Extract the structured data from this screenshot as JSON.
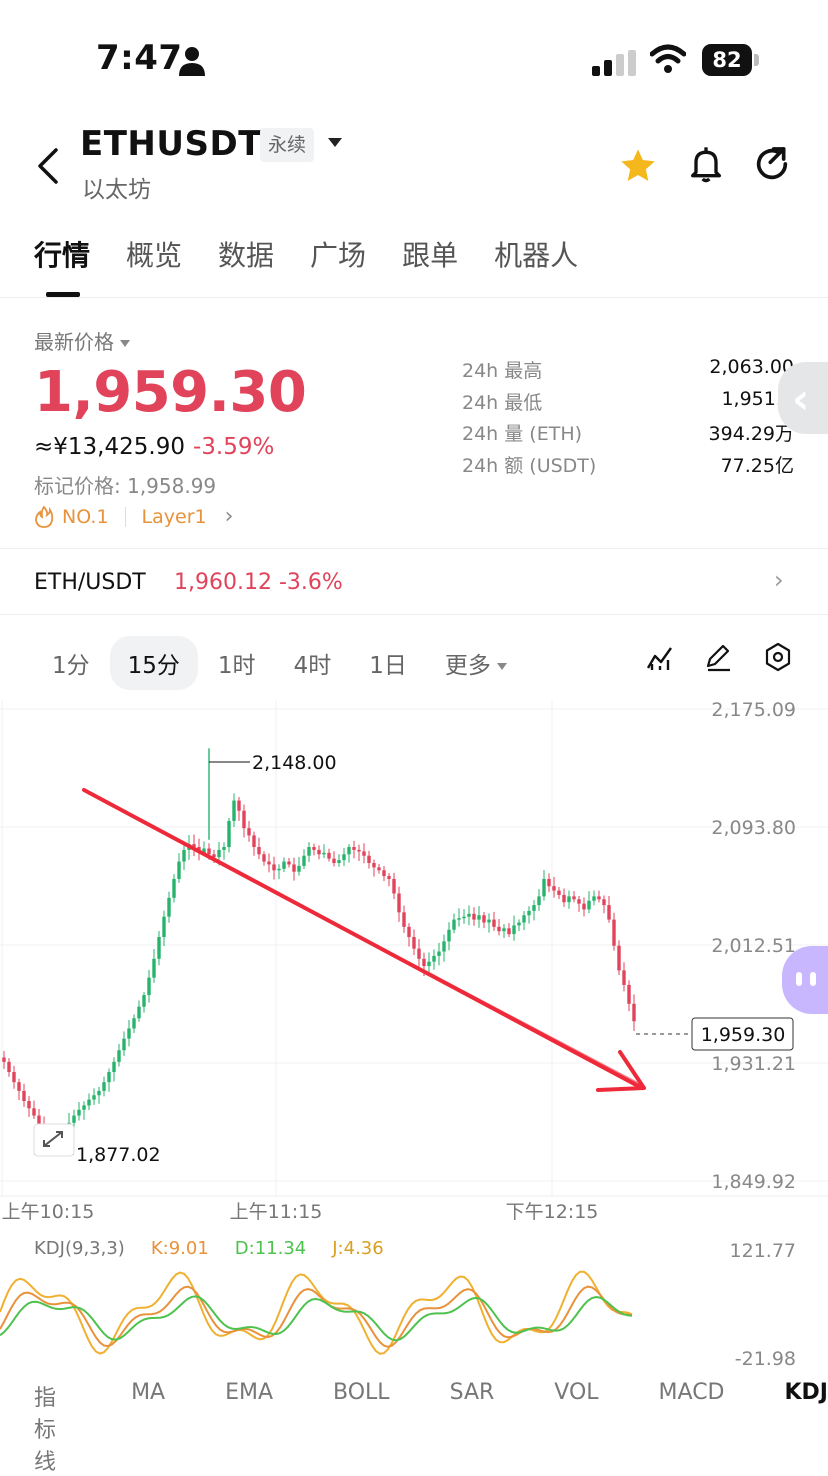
{
  "status_bar": {
    "time": "7:47",
    "battery": "82"
  },
  "header": {
    "symbol": "ETHUSDT",
    "contract_type": "永续",
    "name": "以太坊"
  },
  "tabs": [
    "行情",
    "概览",
    "数据",
    "广场",
    "跟单",
    "机器人"
  ],
  "price_panel": {
    "latest_label": "最新价格",
    "last_price": "1,959.30",
    "cny_price": "≈¥13,425.90",
    "change_pct": "-3.59%",
    "mark_price": "标记价格: 1,958.99",
    "tag_rank": "NO.1",
    "tag_sector": "Layer1"
  },
  "stats": [
    {
      "label": "24h  最高",
      "value": "2,063.00"
    },
    {
      "label": "24h  最低",
      "value": "1,951.3"
    },
    {
      "label": "24h  量 (ETH)",
      "value": "394.29万"
    },
    {
      "label": "24h  额 (USDT)",
      "value": "77.25亿"
    }
  ],
  "spot": {
    "pair": "ETH/USDT",
    "price": "1,960.12",
    "change": "-3.6%"
  },
  "intervals": [
    "1分",
    "15分",
    "1时",
    "4时",
    "1日",
    "更多"
  ],
  "active_interval": "15分",
  "colors": {
    "up": "#28b36b",
    "down": "#e0435a",
    "accent_red": "#ee2a3a",
    "star": "#f5b81c"
  },
  "chart_data": {
    "type": "candlestick",
    "y_axis_ticks": [
      "2,175.09",
      "2,093.80",
      "2,012.51",
      "1,931.21",
      "1,849.92"
    ],
    "ylim": [
      1849.92,
      2175.09
    ],
    "x_axis_ticks": [
      "上午10:15",
      "上午11:15",
      "下午12:15"
    ],
    "high_label": "2,148.00",
    "low_label": "1,877.02",
    "current_price_label": "1,959.30",
    "close_series": [
      1932,
      1925,
      1918,
      1912,
      1905,
      1900,
      1895,
      1889,
      1884,
      1880,
      1878,
      1881,
      1886,
      1890,
      1895,
      1899,
      1902,
      1906,
      1909,
      1912,
      1918,
      1925,
      1932,
      1940,
      1948,
      1955,
      1962,
      1970,
      1978,
      1990,
      2003,
      2018,
      2032,
      2045,
      2058,
      2070,
      2078,
      2082,
      2080,
      2076,
      2079,
      2075,
      2073,
      2078,
      2080,
      2098,
      2112,
      2105,
      2093,
      2088,
      2080,
      2075,
      2070,
      2068,
      2064,
      2065,
      2070,
      2068,
      2063,
      2067,
      2074,
      2080,
      2078,
      2075,
      2076,
      2072,
      2069,
      2071,
      2075,
      2080,
      2078,
      2077,
      2074,
      2069,
      2066,
      2064,
      2060,
      2058,
      2048,
      2035,
      2025,
      2018,
      2010,
      2003,
      1998,
      2001,
      2005,
      2008,
      2015,
      2023,
      2030,
      2031,
      2032,
      2034,
      2030,
      2033,
      2028,
      2030,
      2025,
      2022,
      2024,
      2020,
      2026,
      2028,
      2033,
      2036,
      2040,
      2046,
      2058,
      2053,
      2050,
      2047,
      2042,
      2046,
      2044,
      2041,
      2037,
      2043,
      2046,
      2044,
      2040,
      2030,
      2012,
      1995,
      1985,
      1972,
      1960
    ],
    "kdj": {
      "params": "KDJ(9,3,3)",
      "k": "K:9.01",
      "d": "D:11.34",
      "j": "J:4.36",
      "y_max": "121.77",
      "y_min": "-21.98"
    }
  },
  "bottom_tabs": [
    "指标线",
    "MA",
    "EMA",
    "BOLL",
    "SAR",
    "VOL",
    "MACD",
    "KDJ"
  ]
}
